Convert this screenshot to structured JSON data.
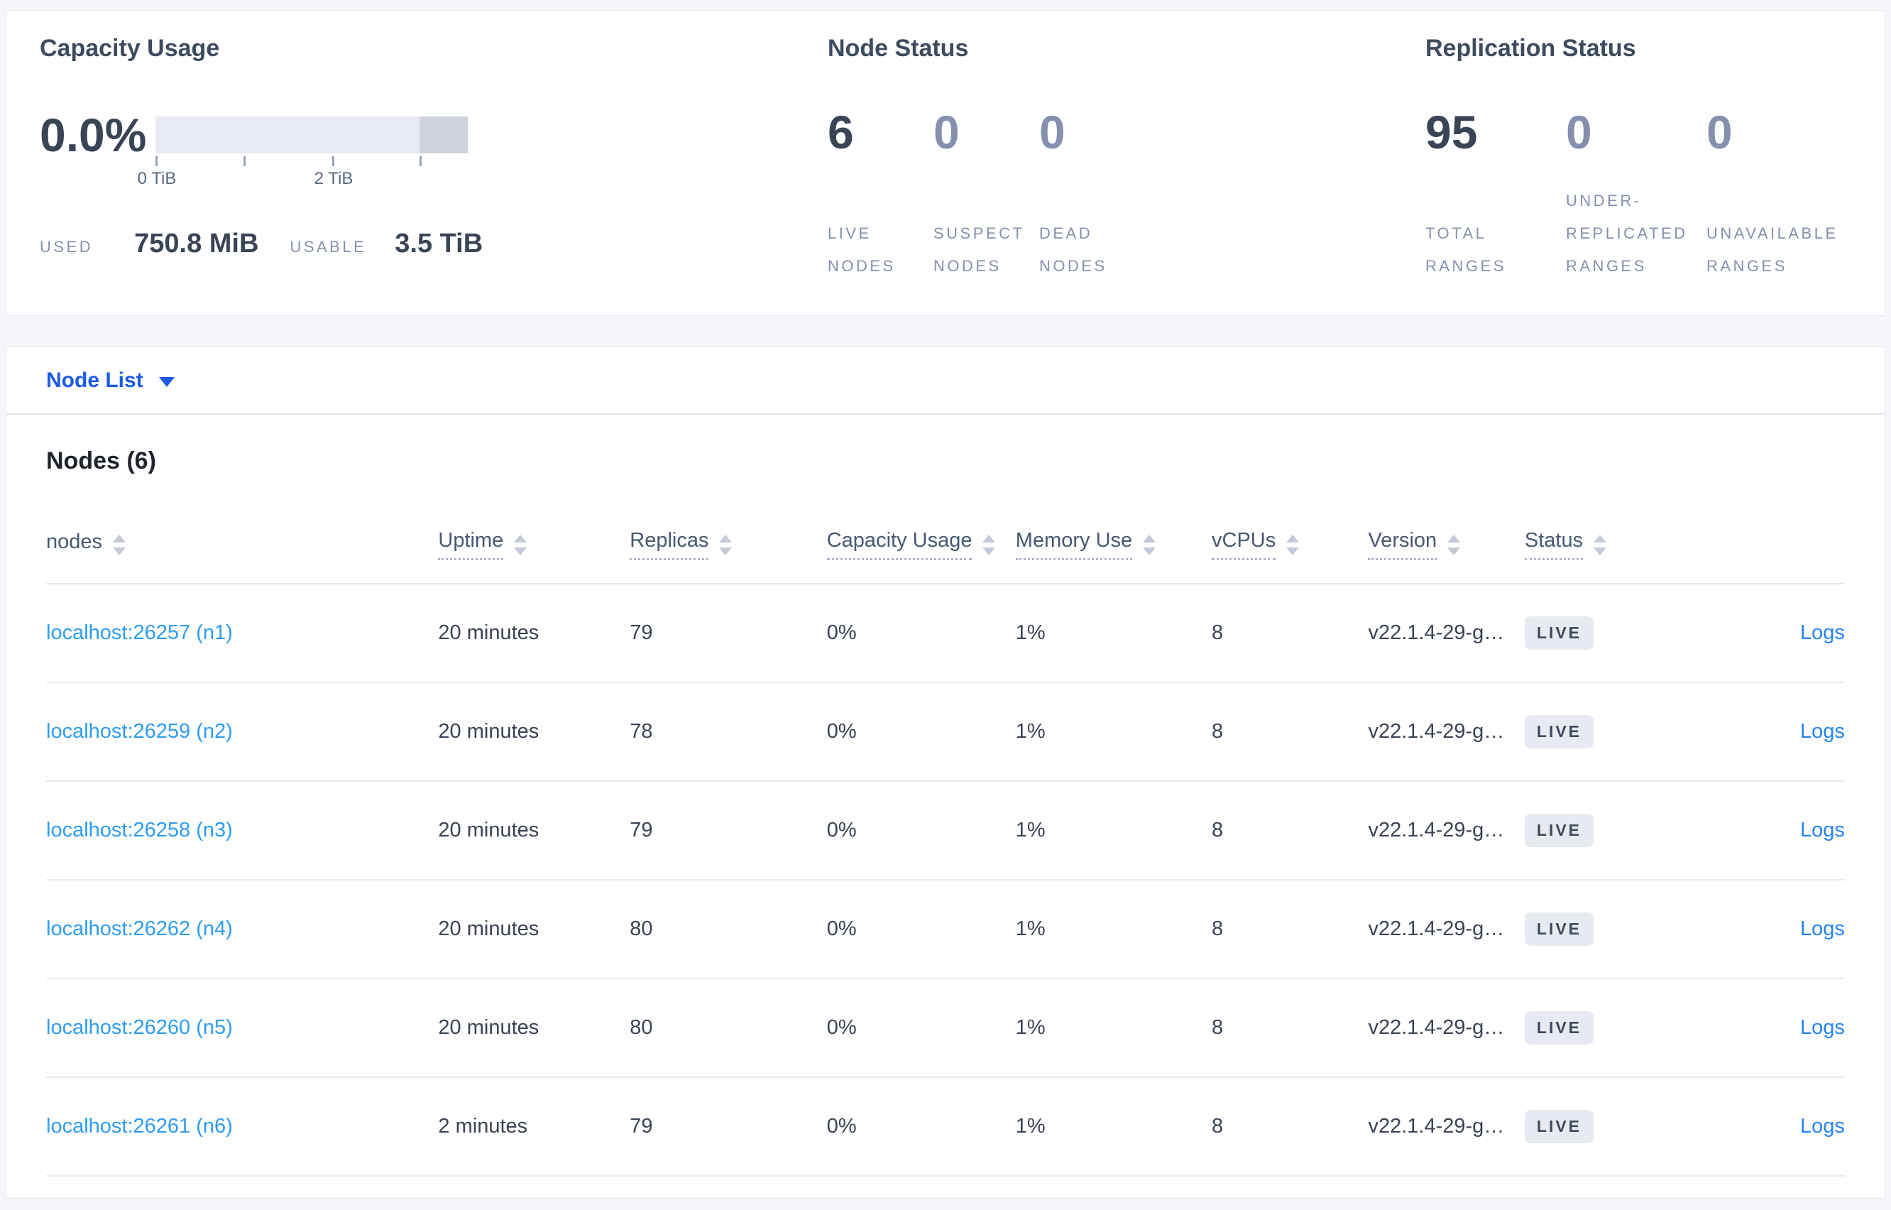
{
  "summary": {
    "capacity": {
      "title": "Capacity Usage",
      "percent": "0.0%",
      "tick_labels": [
        "0 TiB",
        "2 TiB"
      ],
      "used_label": "USED",
      "used_value": "750.8 MiB",
      "usable_label": "USABLE",
      "usable_value": "3.5 TiB"
    },
    "node_status": {
      "title": "Node Status",
      "stats": [
        {
          "value": "6",
          "label": "LIVE NODES"
        },
        {
          "value": "0",
          "label": "SUSPECT NODES"
        },
        {
          "value": "0",
          "label": "DEAD NODES"
        }
      ]
    },
    "replication": {
      "title": "Replication Status",
      "stats": [
        {
          "value": "95",
          "label": "TOTAL RANGES"
        },
        {
          "value": "0",
          "label": "UNDER-REPLICATED RANGES"
        },
        {
          "value": "0",
          "label": "UNAVAILABLE RANGES"
        }
      ]
    }
  },
  "node_list": {
    "label": "Node List"
  },
  "nodes_section": {
    "title": "Nodes (6)",
    "columns": [
      "nodes",
      "Uptime",
      "Replicas",
      "Capacity Usage",
      "Memory Use",
      "vCPUs",
      "Version",
      "Status"
    ],
    "rows": [
      {
        "node": "localhost:26257 (n1)",
        "uptime": "20 minutes",
        "replicas": "79",
        "capacity": "0%",
        "memory": "1%",
        "vcpus": "8",
        "version": "v22.1.4-29-g…",
        "status": "LIVE",
        "logs": "Logs"
      },
      {
        "node": "localhost:26259 (n2)",
        "uptime": "20 minutes",
        "replicas": "78",
        "capacity": "0%",
        "memory": "1%",
        "vcpus": "8",
        "version": "v22.1.4-29-g…",
        "status": "LIVE",
        "logs": "Logs"
      },
      {
        "node": "localhost:26258 (n3)",
        "uptime": "20 minutes",
        "replicas": "79",
        "capacity": "0%",
        "memory": "1%",
        "vcpus": "8",
        "version": "v22.1.4-29-g…",
        "status": "LIVE",
        "logs": "Logs"
      },
      {
        "node": "localhost:26262 (n4)",
        "uptime": "20 minutes",
        "replicas": "80",
        "capacity": "0%",
        "memory": "1%",
        "vcpus": "8",
        "version": "v22.1.4-29-g…",
        "status": "LIVE",
        "logs": "Logs"
      },
      {
        "node": "localhost:26260 (n5)",
        "uptime": "20 minutes",
        "replicas": "80",
        "capacity": "0%",
        "memory": "1%",
        "vcpus": "8",
        "version": "v22.1.4-29-g…",
        "status": "LIVE",
        "logs": "Logs"
      },
      {
        "node": "localhost:26261 (n6)",
        "uptime": "2 minutes",
        "replicas": "79",
        "capacity": "0%",
        "memory": "1%",
        "vcpus": "8",
        "version": "v22.1.4-29-g…",
        "status": "LIVE",
        "logs": "Logs"
      }
    ]
  },
  "colors": {
    "action_blue": "#1b5ae6",
    "node_link_blue": "#2d9cf0",
    "logs_link_blue": "#2584f0",
    "dark_text": "#394455",
    "muted_stat": "#8490ae",
    "badge_bg": "#e7eaf1",
    "bar_light": "#e9ebf2",
    "bar_dark": "#ced3de"
  }
}
